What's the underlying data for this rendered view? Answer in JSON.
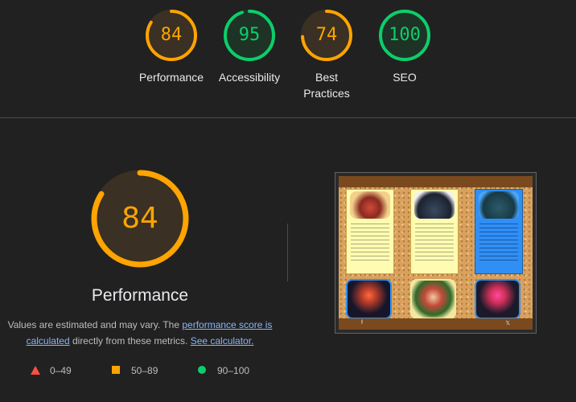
{
  "colors": {
    "average": "#ffa400",
    "pass": "#0cce6b",
    "fail": "#ff4e42",
    "text": "#e8eaed",
    "link": "#8ab4f8"
  },
  "categories": [
    {
      "label": "Performance",
      "score": "84",
      "fraction": 0.84,
      "status": "average"
    },
    {
      "label": "Accessibility",
      "score": "95",
      "fraction": 0.95,
      "status": "pass"
    },
    {
      "label": "Best Practices",
      "score": "74",
      "fraction": 0.74,
      "status": "average"
    },
    {
      "label": "SEO",
      "score": "100",
      "fraction": 1.0,
      "status": "pass"
    }
  ],
  "main": {
    "score": "84",
    "fraction": 0.84,
    "title": "Performance",
    "desc_prefix": "Values are estimated and may vary. The ",
    "desc_link": "performance score is calculated",
    "desc_middle": " directly from these metrics. ",
    "desc_calc_link": "See calculator."
  },
  "legend": [
    {
      "range": "0–49",
      "shape": "triangle"
    },
    {
      "range": "50–89",
      "shape": "square"
    },
    {
      "range": "90–100",
      "shape": "circle"
    }
  ],
  "screenshot": {
    "icons": [
      "facebook-icon",
      "x-icon"
    ]
  }
}
